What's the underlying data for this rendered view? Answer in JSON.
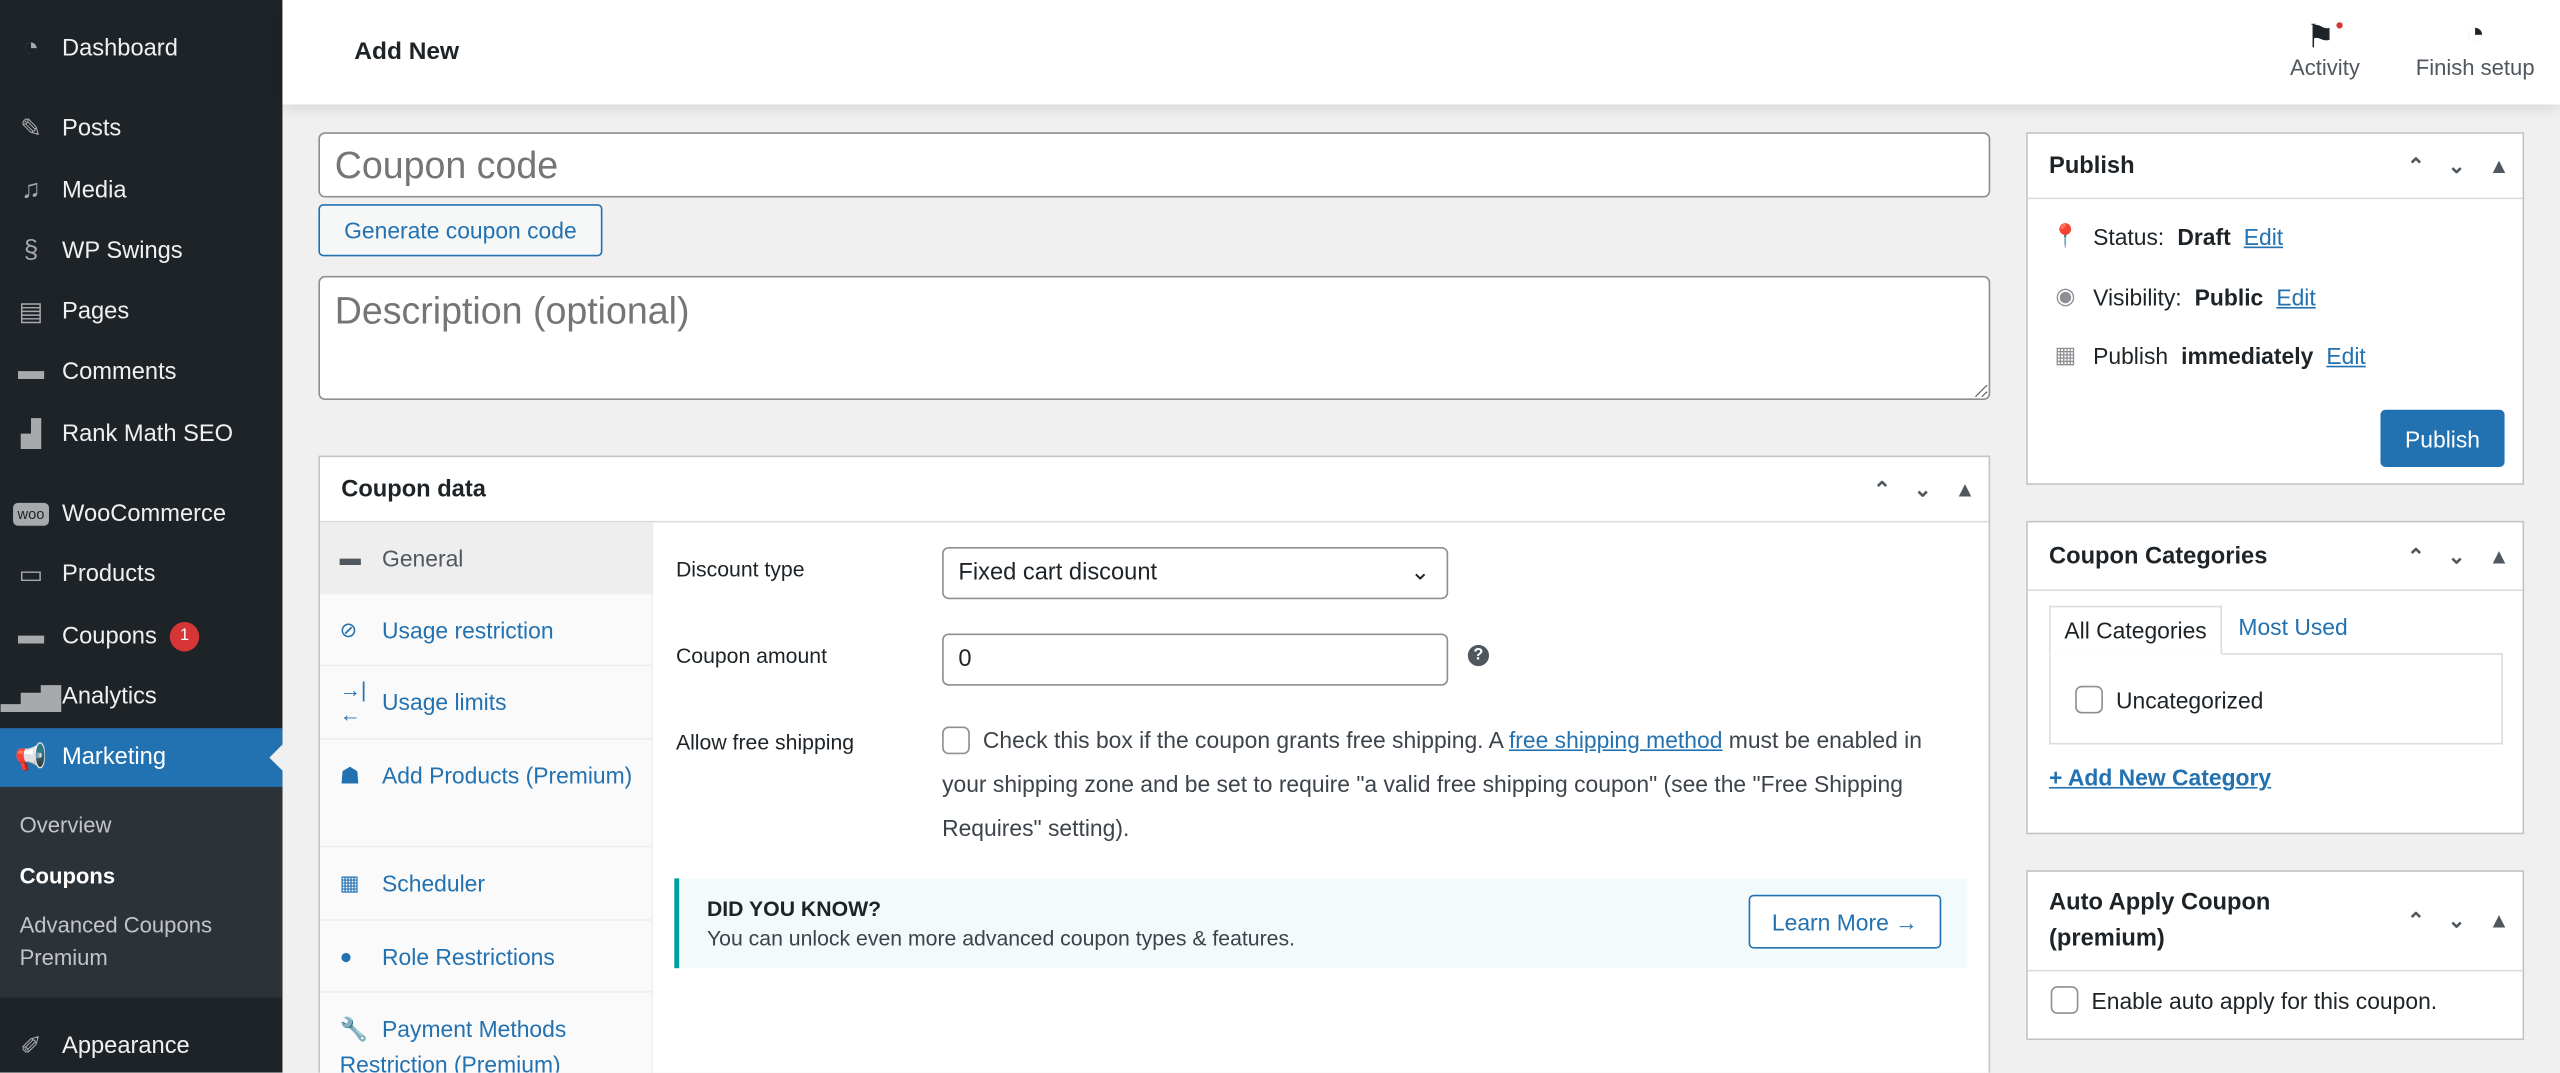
{
  "sidebar": {
    "items": [
      {
        "label": "Dashboard",
        "icon": "dashboard-icon"
      },
      {
        "label": "Posts",
        "icon": "pin-icon"
      },
      {
        "label": "Media",
        "icon": "media-icon"
      },
      {
        "label": "WP Swings",
        "icon": "wp-swings-icon"
      },
      {
        "label": "Pages",
        "icon": "pages-icon"
      },
      {
        "label": "Comments",
        "icon": "comment-icon"
      },
      {
        "label": "Rank Math SEO",
        "icon": "rank-math-icon"
      },
      {
        "label": "WooCommerce",
        "icon": "woo-icon"
      },
      {
        "label": "Products",
        "icon": "archive-icon"
      },
      {
        "label": "Coupons",
        "icon": "ticket-icon",
        "badge": "1"
      },
      {
        "label": "Analytics",
        "icon": "bar-chart-icon"
      },
      {
        "label": "Marketing",
        "icon": "megaphone-icon",
        "active": true
      },
      {
        "label": "Appearance",
        "icon": "brush-icon"
      }
    ],
    "submenu": [
      "Overview",
      "Coupons",
      "Advanced Coupons Premium"
    ]
  },
  "header": {
    "title": "Add New",
    "activity": "Activity",
    "finish_setup": "Finish setup"
  },
  "coupon": {
    "code_placeholder": "Coupon code",
    "generate_label": "Generate coupon code",
    "description_placeholder": "Description (optional)"
  },
  "coupon_data": {
    "title": "Coupon data",
    "tabs": [
      "General",
      "Usage restriction",
      "Usage limits",
      "Add Products (Premium)",
      "Scheduler",
      "Role Restrictions",
      "Payment Methods Restriction (Premium)"
    ],
    "discount_type_label": "Discount type",
    "discount_type_value": "Fixed cart discount",
    "amount_label": "Coupon amount",
    "amount_value": "0",
    "free_shipping_label": "Allow free shipping",
    "free_shipping_text_1": "Check this box if the coupon grants free shipping. A ",
    "free_shipping_link": "free shipping method",
    "free_shipping_text_2": " must be enabled in your shipping zone and be set to require \"a valid free shipping coupon\" (see the \"Free Shipping Requires\" setting).",
    "notice_title": "DID YOU KNOW?",
    "notice_text": "You can unlock even more advanced coupon types & features.",
    "learn_more": "Learn More →"
  },
  "publish": {
    "title": "Publish",
    "status_label": "Status:",
    "status_value": "Draft",
    "visibility_label": "Visibility:",
    "visibility_value": "Public",
    "publish_label": "Publish",
    "publish_value": "immediately",
    "edit": "Edit",
    "button": "Publish"
  },
  "categories": {
    "title": "Coupon Categories",
    "tab_all": "All Categories",
    "tab_most": "Most Used",
    "items": [
      "Uncategorized"
    ],
    "add_new": "+ Add New Category"
  },
  "auto_apply": {
    "title": "Auto Apply Coupon (premium)",
    "checkbox_label": "Enable auto apply for this coupon."
  },
  "colors": {
    "sidebar": "#1d2327",
    "accent": "#2271b1",
    "badge": "#d63638",
    "notice_border": "#00a0a0"
  }
}
